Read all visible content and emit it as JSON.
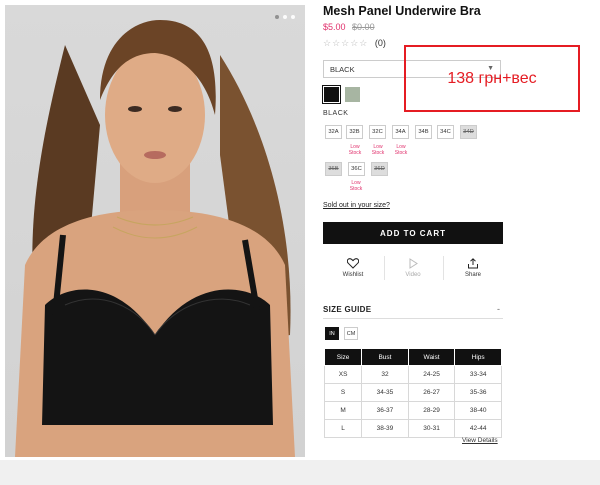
{
  "product": {
    "title": "Mesh Panel Underwire Bra",
    "sale_price": "$5.00",
    "original_price": "$0.00",
    "rating_stars": "☆☆☆☆☆",
    "review_count": "(0)"
  },
  "color_select": {
    "value": "BLACK",
    "selected_color_name": "BLACK",
    "swatches": [
      {
        "name": "Black",
        "color": "#111111"
      },
      {
        "name": "Sage",
        "color": "#a7b5a2"
      }
    ]
  },
  "sizes": [
    {
      "label": "32A",
      "available": true,
      "low_stock": false
    },
    {
      "label": "32B",
      "available": true,
      "low_stock": true
    },
    {
      "label": "32C",
      "available": true,
      "low_stock": true
    },
    {
      "label": "34A",
      "available": true,
      "low_stock": true
    },
    {
      "label": "34B",
      "available": true,
      "low_stock": false
    },
    {
      "label": "34C",
      "available": true,
      "low_stock": false
    },
    {
      "label": "34D",
      "available": false,
      "low_stock": false
    },
    {
      "label": "36B",
      "available": false,
      "low_stock": false
    },
    {
      "label": "36C",
      "available": true,
      "low_stock": true
    },
    {
      "label": "36D",
      "available": false,
      "low_stock": false
    }
  ],
  "low_stock_label": "Low Stock",
  "sold_out_link": "Sold out in your size?",
  "add_to_cart": "ADD TO CART",
  "actions": {
    "wishlist": "Wishlist",
    "video": "Video",
    "share": "Share"
  },
  "size_guide": {
    "title": "SIZE GUIDE",
    "toggle": "-",
    "unit_in": "IN",
    "unit_cm": "CM",
    "headers": [
      "Size",
      "Bust",
      "Waist",
      "Hips"
    ],
    "rows": [
      [
        "XS",
        "32",
        "24-25",
        "33-34"
      ],
      [
        "S",
        "34-35",
        "26-27",
        "35-36"
      ],
      [
        "M",
        "36-37",
        "28-29",
        "38-40"
      ],
      [
        "L",
        "38-39",
        "30-31",
        "42-44"
      ]
    ],
    "view_details": "View Details"
  },
  "annotation": {
    "text": "138 грн+вес",
    "color": "#e51c23"
  },
  "colors": {
    "accent_price": "#e0306c",
    "button_bg": "#111111"
  }
}
